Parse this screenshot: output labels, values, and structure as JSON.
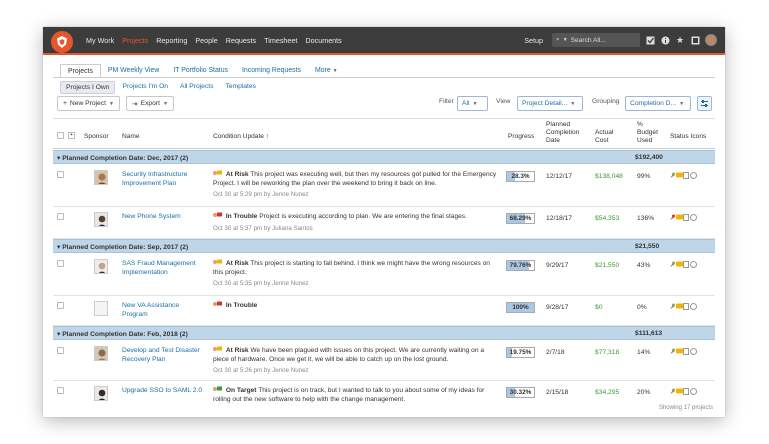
{
  "nav": {
    "items": [
      "My Work",
      "Projects",
      "Reporting",
      "People",
      "Requests",
      "Timesheet",
      "Documents"
    ],
    "active": "Projects",
    "setup_label": "Setup",
    "search_placeholder": "Search All..."
  },
  "tabs": [
    "Projects",
    "PM Weekly View",
    "IT Portfolio Status",
    "Incoming Requests",
    "More"
  ],
  "subtabs": [
    "Projects I Own",
    "Projects I'm On",
    "All Projects",
    "Templates"
  ],
  "toolbar": {
    "new_project": "New Project",
    "export": "Export",
    "filter_label": "Filter",
    "filter_value": "All",
    "view_label": "View",
    "view_value": "Project Detail...",
    "grouping_label": "Grouping",
    "grouping_value": "Completion D..."
  },
  "columns": {
    "sponsor": "Sponsor",
    "name": "Name",
    "condition": "Condition Update ↑",
    "progress": "Progress",
    "planned": [
      "Planned",
      "Completion",
      "Date"
    ],
    "actual": [
      "Actual",
      "Cost"
    ],
    "budget": [
      "%",
      "Budget",
      "Used"
    ],
    "status": "Status Icons"
  },
  "groups": [
    {
      "label": "Planned Completion Date: Dec, 2017 (2)",
      "total": "$192,400",
      "rows": [
        {
          "name": "Security Infrastructure Improvement Plan",
          "status": "At Risk",
          "status_color": "#f2b400",
          "text": "This project was executing well, but then my resources got pulled for the Emergency Project. I will be reworking the plan over the weekend to bring it back on line.",
          "meta": "Oct 30 at 5:29 pm by Jenne Nunez",
          "progress": "28.3%",
          "progress_value": 28.3,
          "date": "12/12/17",
          "cost": "$138,048",
          "budget": "99%"
        },
        {
          "name": "New Phone System",
          "status": "In Trouble",
          "status_color": "#d9342b",
          "text": "Project is executing according to plan. We are entering the final stages.",
          "meta": "Oct 30 at 5:37 pm by Juliana Santos",
          "progress": "68.29%",
          "progress_value": 68.29,
          "date": "12/18/17",
          "cost": "$54,353",
          "budget": "136%"
        }
      ]
    },
    {
      "label": "Planned Completion Date: Sep, 2017 (2)",
      "total": "$21,550",
      "rows": [
        {
          "name": "SAS Fraud Management Implementation",
          "status": "At Risk",
          "status_color": "#f2b400",
          "text": "This project is starting to fall behind. I think we might have the wrong resources on this project.",
          "meta": "Oct 30 at 5:35 pm by Jenne Nunez",
          "progress": "79.76%",
          "progress_value": 79.76,
          "date": "9/29/17",
          "cost": "$21,550",
          "budget": "43%"
        },
        {
          "name": "New VA Assistance Program",
          "status": "In Trouble",
          "status_color": "#d9342b",
          "text": "",
          "meta": "",
          "progress": "100%",
          "progress_value": 100,
          "date": "9/28/17",
          "cost": "$0",
          "budget": "0%"
        }
      ]
    },
    {
      "label": "Planned Completion Date: Feb, 2018 (2)",
      "total": "$111,613",
      "rows": [
        {
          "name": "Develop and Test Disaster Recovery Plan",
          "status": "At Risk",
          "status_color": "#f2b400",
          "text": "We have been plagued with issues on this project. We are currently waiting on a piece of hardware. Once we get it, we will be able to catch up on the lost ground.",
          "meta": "Oct 30 at 5:26 pm by Jenne Nunez",
          "progress": "19.75%",
          "progress_value": 19.75,
          "date": "2/7/18",
          "cost": "$77,318",
          "budget": "14%"
        },
        {
          "name": "Upgrade SSO to SAML 2.0",
          "status": "On Target",
          "status_color": "#3a9a35",
          "text": "This project is on track, but I wanted to talk to you about some of my ideas for rolling out the new software to help with the change management.",
          "meta": "",
          "progress": "30.32%",
          "progress_value": 30.32,
          "date": "2/15/18",
          "cost": "$34,295",
          "budget": "20%"
        }
      ]
    }
  ],
  "footer": "Showing 17 projects"
}
